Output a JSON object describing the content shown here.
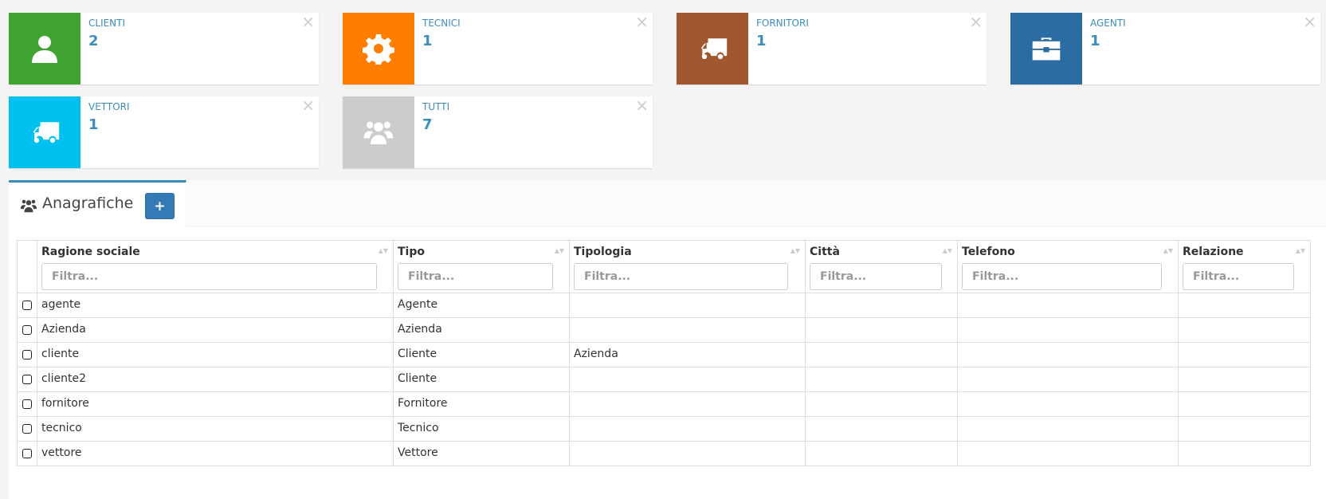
{
  "info_boxes": [
    {
      "label": "CLIENTI",
      "count": "2",
      "color": "#3ea330",
      "icon": "user-icon"
    },
    {
      "label": "TECNICI",
      "count": "1",
      "color": "#ff7e00",
      "icon": "gear-icon"
    },
    {
      "label": "FORNITORI",
      "count": "1",
      "color": "#a0572e",
      "icon": "truck-icon"
    },
    {
      "label": "AGENTI",
      "count": "1",
      "color": "#2b6da3",
      "icon": "briefcase-icon"
    },
    {
      "label": "VETTORI",
      "count": "1",
      "color": "#00c0ef",
      "icon": "truck-icon"
    },
    {
      "label": "TUTTI",
      "count": "7",
      "color": "#cccccc",
      "icon": "users-icon"
    }
  ],
  "close_glyph": "×",
  "panel": {
    "title": "Anagrafiche",
    "title_icon": "users-icon",
    "add_glyph": "+"
  },
  "table": {
    "columns": [
      "Ragione sociale",
      "Tipo",
      "Tipologia",
      "Città",
      "Telefono",
      "Relazione"
    ],
    "filter_placeholder": "Filtra...",
    "rows": [
      [
        "agente",
        "Agente",
        "",
        "",
        "",
        ""
      ],
      [
        "Azienda",
        "Azienda",
        "",
        "",
        "",
        ""
      ],
      [
        "cliente",
        "Cliente",
        "Azienda",
        "",
        "",
        ""
      ],
      [
        "cliente2",
        "Cliente",
        "",
        "",
        "",
        ""
      ],
      [
        "fornitore",
        "Fornitore",
        "",
        "",
        "",
        ""
      ],
      [
        "tecnico",
        "Tecnico",
        "",
        "",
        "",
        ""
      ],
      [
        "vettore",
        "Vettore",
        "",
        "",
        "",
        ""
      ]
    ]
  }
}
